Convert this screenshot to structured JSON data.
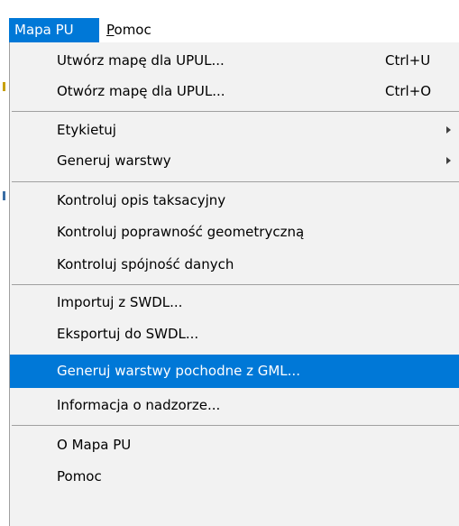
{
  "menubar": {
    "items": [
      {
        "label": "Mapa PU",
        "state": "open"
      },
      {
        "label_mnemonic": "P",
        "label_rest": "omoc",
        "state": "closed"
      }
    ]
  },
  "dropdown": {
    "items": [
      {
        "label": "Utwórz mapę dla UPUL...",
        "shortcut": "Ctrl+U"
      },
      {
        "label": "Otwórz mapę dla UPUL...",
        "shortcut": "Ctrl+O"
      },
      {
        "label": "Etykietuj",
        "submenu": true
      },
      {
        "label": "Generuj warstwy",
        "submenu": true
      },
      {
        "label": "Kontroluj opis taksacyjny"
      },
      {
        "label": "Kontroluj poprawność geometryczną"
      },
      {
        "label": "Kontroluj spójność danych"
      },
      {
        "label": "Importuj z SWDL..."
      },
      {
        "label": "Eksportuj do SWDL..."
      },
      {
        "label": "Generuj warstwy pochodne z GML...",
        "highlighted": true
      },
      {
        "label": "Informacja o nadzorze..."
      },
      {
        "label": "O Mapa PU"
      },
      {
        "label": "Pomoc"
      }
    ],
    "arrow_icon": "chevron-right-icon"
  },
  "colors": {
    "highlight": "#0078d7",
    "menu_background": "#f2f2f2",
    "separator": "#a0a0a0",
    "highlight_text": "#ffffff"
  }
}
